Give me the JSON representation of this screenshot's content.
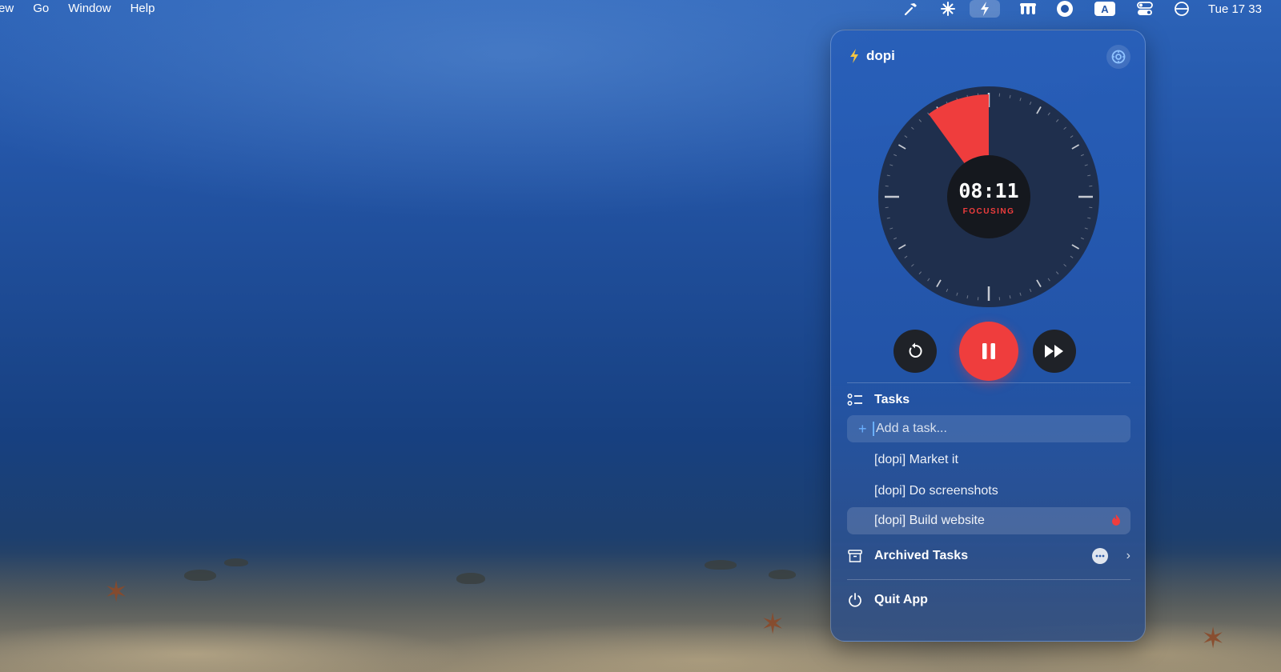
{
  "menubar": {
    "menus": [
      "ew",
      "Go",
      "Window",
      "Help"
    ],
    "status_icons": [
      "hammer-icon",
      "sparkle-icon",
      "bolt-icon",
      "menu-extra-icon",
      "record-icon",
      "input-source-icon",
      "control-center-icon",
      "focus-icon"
    ],
    "input_source_label": "A",
    "clock": "Tue 17 33"
  },
  "panel": {
    "app_name": "dopi",
    "timer": {
      "time": "08:11",
      "state": "FOCUSING",
      "progress_fraction": 0.1
    },
    "controls": {
      "reset_icon": "reset-icon",
      "pause_icon": "pause-icon",
      "skip_icon": "skip-forward-icon"
    },
    "tasks": {
      "header": "Tasks",
      "add_placeholder": "Add a task...",
      "items": [
        {
          "label": "[dopi] Market it"
        },
        {
          "label": "[dopi] Do screenshots"
        },
        {
          "label": "[dopi] Build website"
        }
      ]
    },
    "archived": {
      "label": "Archived Tasks"
    },
    "quit": {
      "label": "Quit App"
    }
  },
  "colors": {
    "accent_red": "#ef3d3d",
    "input_accent": "#6ab0ff",
    "bolt_yellow": "#f4c542"
  }
}
